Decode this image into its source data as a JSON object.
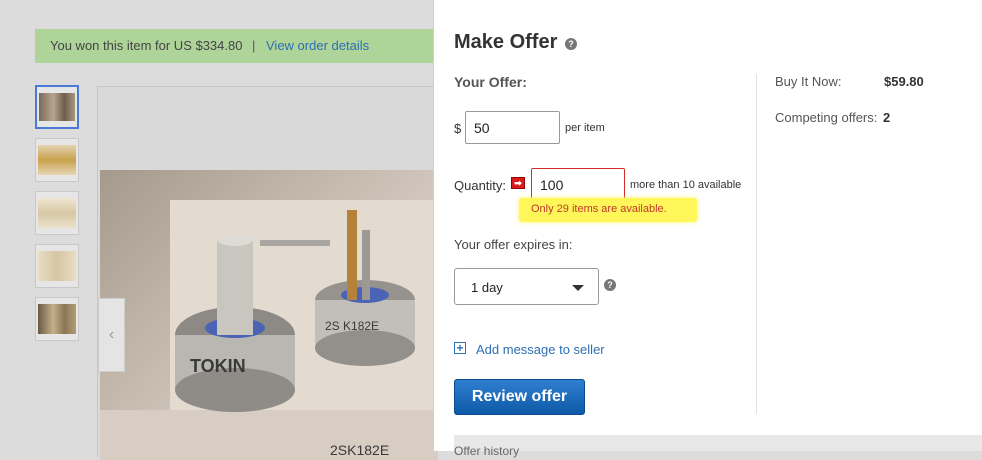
{
  "listing": {
    "banner_text": "You won this item for US $334.80",
    "banner_separator": "|",
    "banner_link": "View order details",
    "thumbnail_count": 5,
    "selected_thumbnail": 1,
    "prev_arrow": "‹",
    "photo_description_icon": "transistor-photo"
  },
  "modal": {
    "title": "Make Offer",
    "help_glyph": "?",
    "your_offer_label": "Your Offer:",
    "currency_symbol": "$",
    "offer_value": "50",
    "per_item_label": "per item",
    "quantity_label": "Quantity:",
    "quantity_arrow_glyph": "➡",
    "quantity_value": "100",
    "available_text": "more than 10 available",
    "quantity_error": "Only 29 items are available.",
    "expires_label": "Your offer expires in:",
    "expires_value": "1 day",
    "add_message_plus": "+",
    "add_message_label": "Add message to seller",
    "review_button": "Review offer",
    "buy_it_now_label": "Buy It Now:",
    "buy_it_now_value": "$59.80",
    "competing_label": "Competing offers:",
    "competing_value": "2",
    "footer_partial_text": "Offer history"
  },
  "colors": {
    "banner_bg": "#aed49a",
    "link": "#2d6fb3",
    "button_bg": "#0e5aa8",
    "error_text": "#c0392b",
    "error_highlight": "#fff65a",
    "error_border": "#d42b2b"
  }
}
